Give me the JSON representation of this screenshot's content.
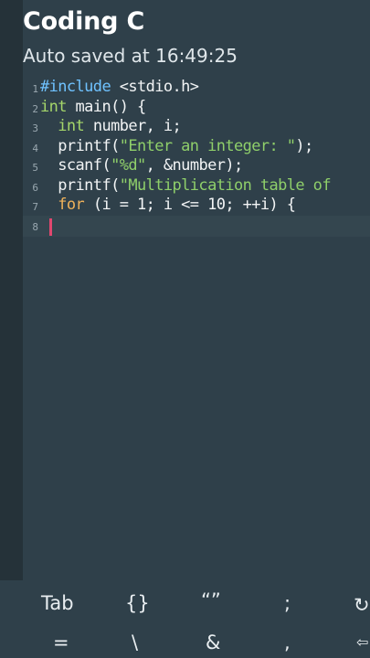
{
  "header": {
    "title": "Coding C",
    "subtitle": "Auto saved at 16:49:25"
  },
  "editor": {
    "lines": [
      {
        "num": "1",
        "parts": [
          [
            "kw",
            "#include"
          ],
          [
            "plain",
            " <stdio.h>"
          ]
        ]
      },
      {
        "num": "2",
        "parts": [
          [
            "kw2",
            "int"
          ],
          [
            "plain",
            " main() {"
          ]
        ]
      },
      {
        "num": "3",
        "parts": [
          [
            "plain",
            "  "
          ],
          [
            "kw2",
            "int"
          ],
          [
            "plain",
            " number, i;"
          ]
        ]
      },
      {
        "num": "4",
        "parts": [
          [
            "plain",
            "  printf("
          ],
          [
            "str",
            "\"Enter an integer: \""
          ],
          [
            "plain",
            ");"
          ]
        ]
      },
      {
        "num": "5",
        "parts": [
          [
            "plain",
            "  scanf("
          ],
          [
            "str",
            "\"%d\""
          ],
          [
            "plain",
            ", &number);"
          ]
        ]
      },
      {
        "num": "6",
        "parts": [
          [
            "plain",
            "  printf("
          ],
          [
            "str",
            "\"Multiplication table of"
          ]
        ]
      },
      {
        "num": "7",
        "parts": [
          [
            "plain",
            "  "
          ],
          [
            "kwfor",
            "for"
          ],
          [
            "plain",
            " (i = 1; i <= 10; ++i) {"
          ]
        ]
      },
      {
        "num": "8",
        "parts": []
      }
    ]
  },
  "keyboard": {
    "row1": [
      "Tab",
      "{}",
      "“”",
      ";",
      "↻"
    ],
    "row2": [
      "=",
      "\\",
      "&",
      ",",
      "⇦"
    ]
  }
}
